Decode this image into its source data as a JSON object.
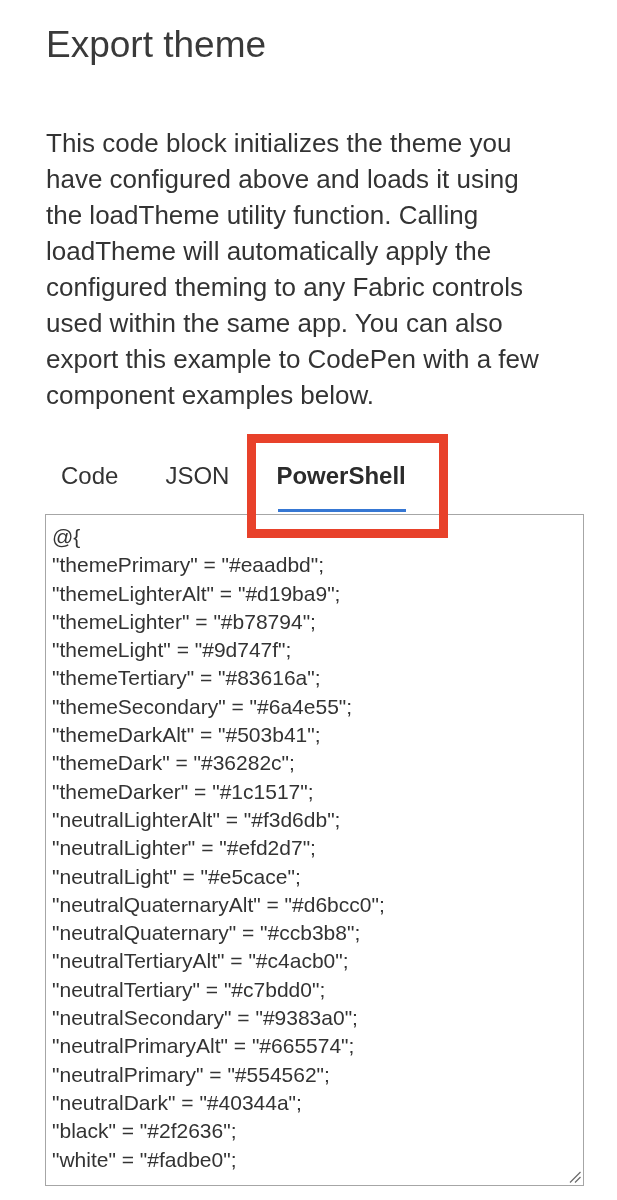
{
  "heading": "Export theme",
  "description": {
    "lines": [
      "This code block initializes the theme you",
      "have configured above and loads it using",
      "the loadTheme utility function. Calling",
      "loadTheme will automatically apply the",
      "configured theming to any Fabric controls",
      "used within the same app. You can also",
      "export this example to CodePen with a few",
      "component examples below."
    ]
  },
  "tabs": [
    {
      "label": "Code",
      "selected": false,
      "highlighted": false
    },
    {
      "label": "JSON",
      "selected": false,
      "highlighted": false
    },
    {
      "label": "PowerShell",
      "selected": true,
      "highlighted": true
    }
  ],
  "code_field": {
    "lines": [
      "@{",
      "\"themePrimary\" = \"#eaadbd\";",
      "\"themeLighterAlt\" = \"#d19ba9\";",
      "\"themeLighter\" = \"#b78794\";",
      "\"themeLight\" = \"#9d747f\";",
      "\"themeTertiary\" = \"#83616a\";",
      "\"themeSecondary\" = \"#6a4e55\";",
      "\"themeDarkAlt\" = \"#503b41\";",
      "\"themeDark\" = \"#36282c\";",
      "\"themeDarker\" = \"#1c1517\";",
      "\"neutralLighterAlt\" = \"#f3d6db\";",
      "\"neutralLighter\" = \"#efd2d7\";",
      "\"neutralLight\" = \"#e5cace\";",
      "\"neutralQuaternaryAlt\" = \"#d6bcc0\";",
      "\"neutralQuaternary\" = \"#ccb3b8\";",
      "\"neutralTertiaryAlt\" = \"#c4acb0\";",
      "\"neutralTertiary\" = \"#c7bdd0\";",
      "\"neutralSecondary\" = \"#9383a0\";",
      "\"neutralPrimaryAlt\" = \"#665574\";",
      "\"neutralPrimary\" = \"#554562\";",
      "\"neutralDark\" = \"#40344a\";",
      "\"black\" = \"#2f2636\";",
      "\"white\" = \"#fadbe0\";"
    ]
  }
}
